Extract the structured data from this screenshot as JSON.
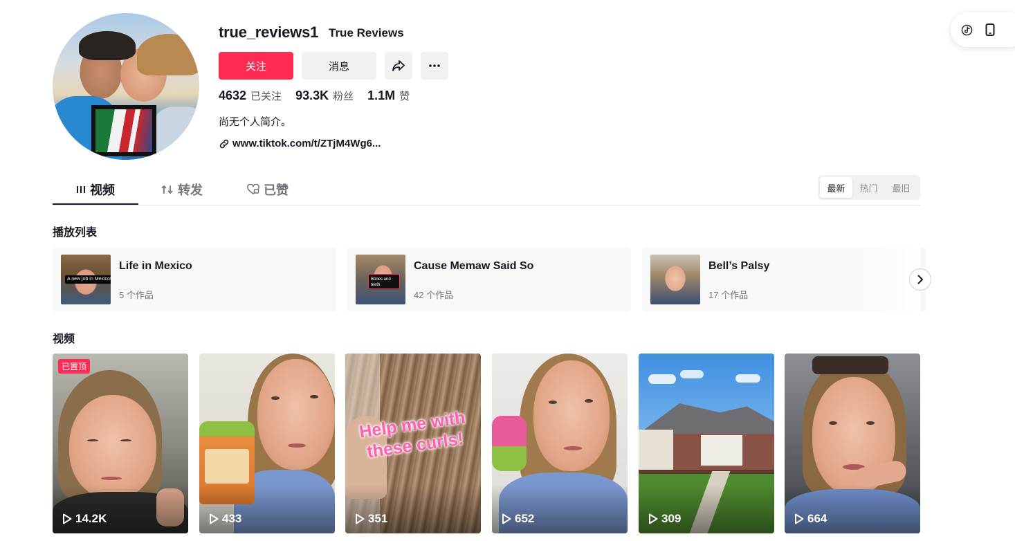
{
  "profile": {
    "username": "true_reviews1",
    "nickname": "True Reviews",
    "follow_label": "关注",
    "message_label": "消息",
    "bio": "尚无个人简介。",
    "link": "www.tiktok.com/t/ZTjM4Wg6...",
    "stats": [
      {
        "value": "4632",
        "label": "已关注"
      },
      {
        "value": "93.3K",
        "label": "粉丝"
      },
      {
        "value": "1.1M",
        "label": "赞"
      }
    ]
  },
  "tabs": [
    {
      "label": "视频",
      "icon": "grid-icon",
      "active": true
    },
    {
      "label": "转发",
      "icon": "repost-icon",
      "active": false
    },
    {
      "label": "已赞",
      "icon": "heart-icon",
      "active": false
    }
  ],
  "sort": {
    "options": [
      "最新",
      "热门",
      "最旧"
    ],
    "selected": "最新"
  },
  "playlists": {
    "title": "播放列表",
    "items": [
      {
        "name": "Life in Mexico",
        "count": "5 个作品",
        "thumb_caption": "A new job in Mexico!?"
      },
      {
        "name": "Cause Memaw Said So",
        "count": "42 个作品",
        "thumb_caption": "Bones and teeth"
      },
      {
        "name": "Bell’s Palsy",
        "count": "17 个作品",
        "thumb_caption": ""
      }
    ]
  },
  "videos": {
    "title": "视频",
    "pinned_label": "已置顶",
    "items": [
      {
        "views": "14.2K",
        "pinned": true
      },
      {
        "views": "433",
        "pinned": false
      },
      {
        "views": "351",
        "pinned": false,
        "overlay_text": "Help me with these curls!"
      },
      {
        "views": "652",
        "pinned": false
      },
      {
        "views": "309",
        "pinned": false
      },
      {
        "views": "664",
        "pinned": false
      }
    ]
  },
  "colors": {
    "accent": "#fe2c55",
    "text": "#161823",
    "muted": "#73747b",
    "surface": "#f1f1f2"
  }
}
